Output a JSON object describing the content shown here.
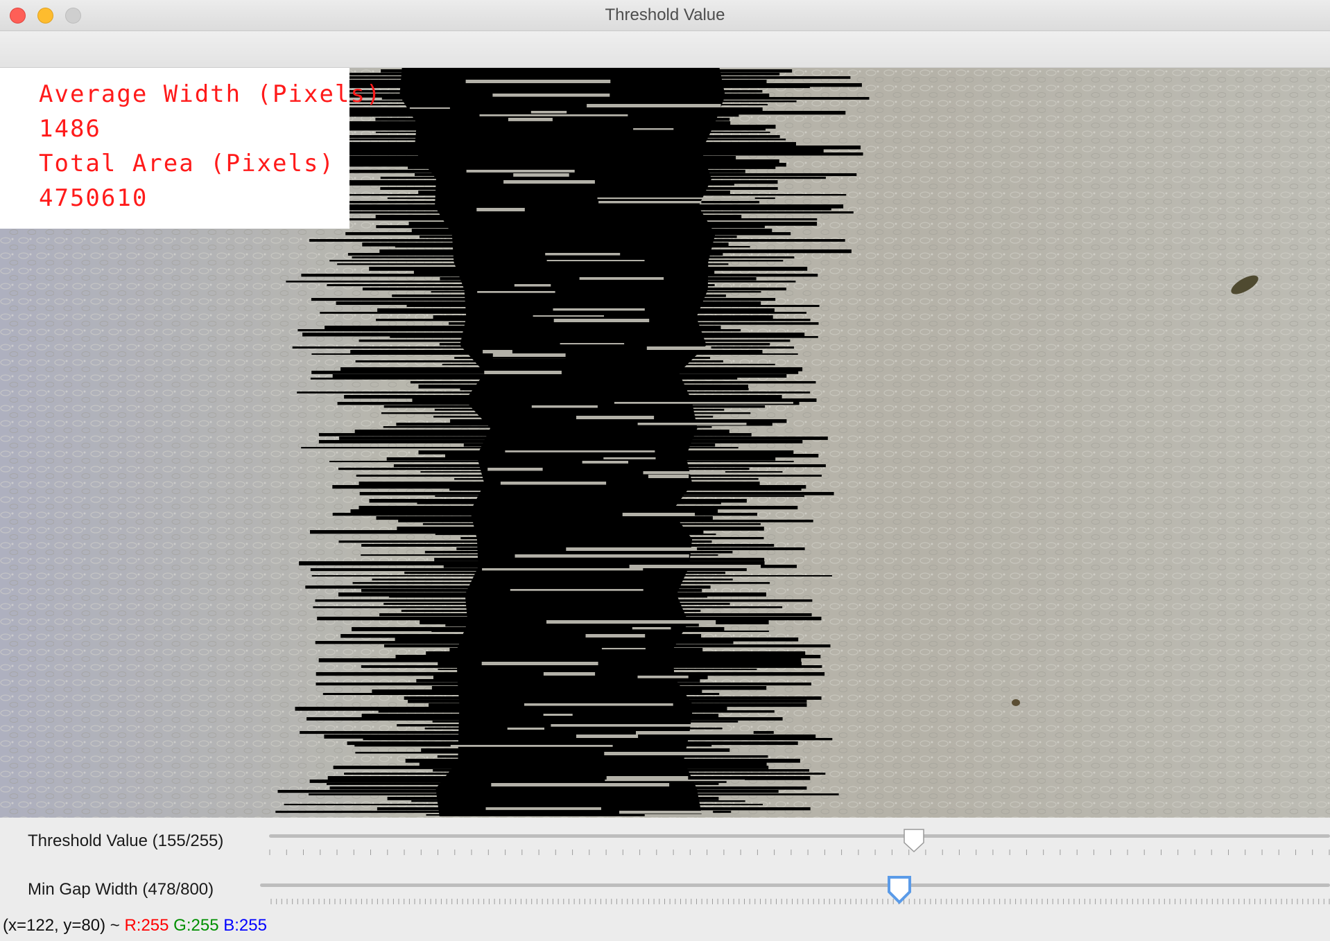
{
  "window": {
    "title": "Threshold Value"
  },
  "overlay": {
    "line1": "Average Width (Pixels)",
    "line2": "1486",
    "line3": "Total Area (Pixels)",
    "line4": "4750610",
    "text_color": "#ff1a1a"
  },
  "sliders": [
    {
      "label": "Threshold Value (155/255)",
      "value": 155,
      "max": 255
    },
    {
      "label": "Min Gap Width (478/800)",
      "value": 478,
      "max": 800
    }
  ],
  "status": {
    "coords": "(x=122, y=80) ~",
    "r": "R:255",
    "g": "G:255",
    "b": "B:255"
  },
  "colors": {
    "traffic_close": "#fe5f57",
    "traffic_min": "#febc2e",
    "traffic_zoom": "#cfcfcf",
    "gap_mask": "#000000",
    "cells": "#b7b5ae"
  }
}
